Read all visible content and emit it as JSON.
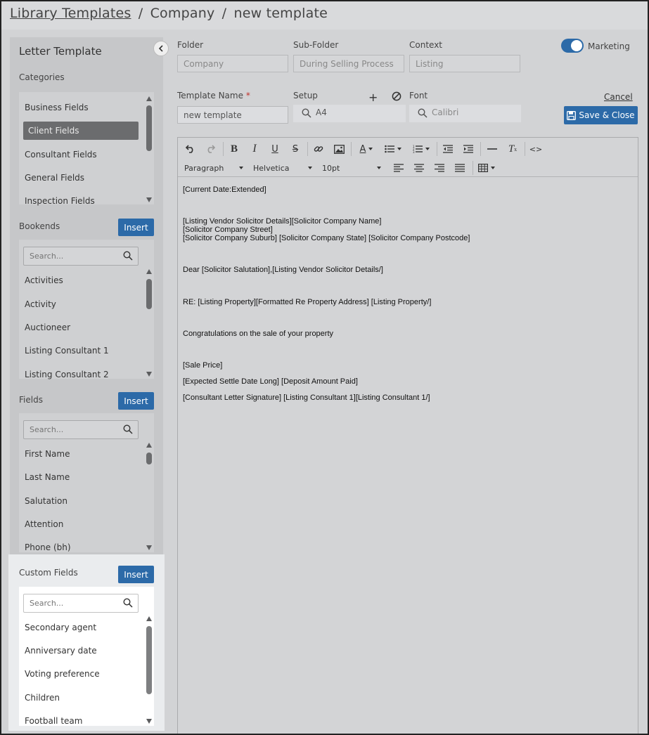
{
  "breadcrumb": {
    "root": "Library Templates",
    "sep": "/",
    "company": "Company",
    "current": "new template"
  },
  "left": {
    "title": "Letter Template",
    "categories": {
      "label": "Categories",
      "items": [
        "Business Fields",
        "Client Fields",
        "Consultant Fields",
        "General Fields",
        "Inspection Fields"
      ],
      "selected_index": 1
    },
    "bookends": {
      "label": "Bookends",
      "insert_label": "Insert",
      "search_placeholder": "Search...",
      "items": [
        "Activities",
        "Activity",
        "Auctioneer",
        "Listing Consultant 1",
        "Listing Consultant 2"
      ]
    },
    "fields": {
      "label": "Fields",
      "insert_label": "Insert",
      "search_placeholder": "Search...",
      "items": [
        "First Name",
        "Last Name",
        "Salutation",
        "Attention",
        "Phone (bh)"
      ]
    },
    "custom_fields": {
      "label": "Custom Fields",
      "insert_label": "Insert",
      "search_placeholder": "Search...",
      "items": [
        "Secondary agent",
        "Anniversary date",
        "Voting preference",
        "Children",
        "Football team"
      ]
    }
  },
  "form": {
    "folder_label": "Folder",
    "folder_value": "Company",
    "subfolder_label": "Sub-Folder",
    "subfolder_value": "During Selling Process",
    "context_label": "Context",
    "context_value": "Listing",
    "marketing_label": "Marketing",
    "marketing_on": true,
    "template_name_label": "Template Name",
    "required_mark": "*",
    "template_name_value": "new template",
    "setup_label": "Setup",
    "setup_value": "A4",
    "add_symbol": "+",
    "font_label": "Font",
    "font_value": "Calibri",
    "cancel_label": "Cancel",
    "save_label": "Save & Close"
  },
  "editor": {
    "toolbar": {
      "format_value": "Paragraph",
      "font_value": "Helvetica",
      "size_value": "10pt"
    },
    "lines": [
      "[Current Date:Extended]",
      "[Listing Vendor Solicitor Details][Solicitor Company Name]",
      "[Solicitor Company Street]",
      "[Solicitor Company Suburb]  [Solicitor Company State]  [Solicitor Company Postcode]",
      "Dear [Solicitor Salutation],[Listing Vendor Solicitor Details/]",
      "RE: [Listing Property][Formatted Re Property Address]    [Listing Property/]",
      "Congratulations on the sale of your property",
      "[Sale Price]",
      "[Expected Settle Date Long]  [Deposit Amount Paid]",
      "[Consultant Letter Signature] [Listing Consultant 1][Listing Consultant 1/]"
    ]
  },
  "colors": {
    "accent": "#2c6aa8",
    "selected_item": "#6b6c6e",
    "required": "#c0312b"
  }
}
